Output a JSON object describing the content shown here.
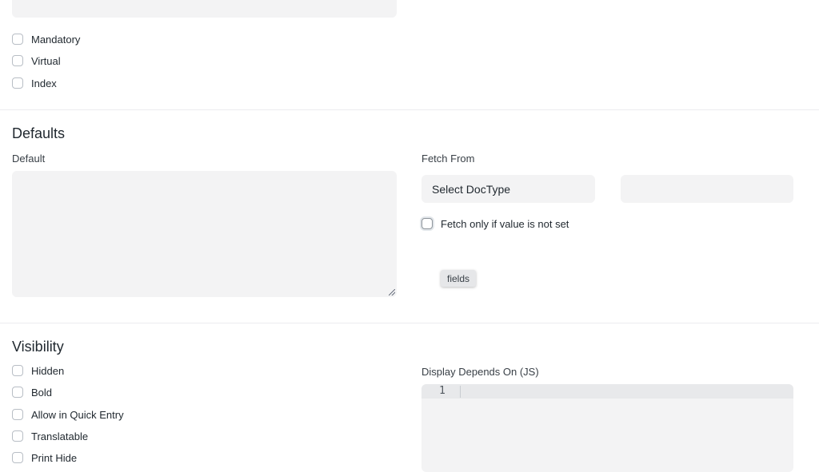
{
  "top_section": {
    "checkboxes": [
      {
        "label": "Mandatory",
        "checked": false
      },
      {
        "label": "Virtual",
        "checked": false
      },
      {
        "label": "Index",
        "checked": false
      }
    ]
  },
  "defaults_section": {
    "title": "Defaults",
    "default_label": "Default",
    "default_value": "",
    "fetch_from_label": "Fetch From",
    "select_doctype_text": "Select DocType",
    "fetch_field_value": "",
    "fetch_only_if_not_set_label": "Fetch only if value is not set",
    "fields_tooltip": "fields"
  },
  "visibility_section": {
    "title": "Visibility",
    "checkboxes": [
      {
        "label": "Hidden",
        "checked": false
      },
      {
        "label": "Bold",
        "checked": false
      },
      {
        "label": "Allow in Quick Entry",
        "checked": false
      },
      {
        "label": "Translatable",
        "checked": false
      },
      {
        "label": "Print Hide",
        "checked": false
      }
    ],
    "display_depends_label": "Display Depends On (JS)",
    "code_editor": {
      "line_numbers": [
        "1"
      ],
      "content": ""
    }
  }
}
